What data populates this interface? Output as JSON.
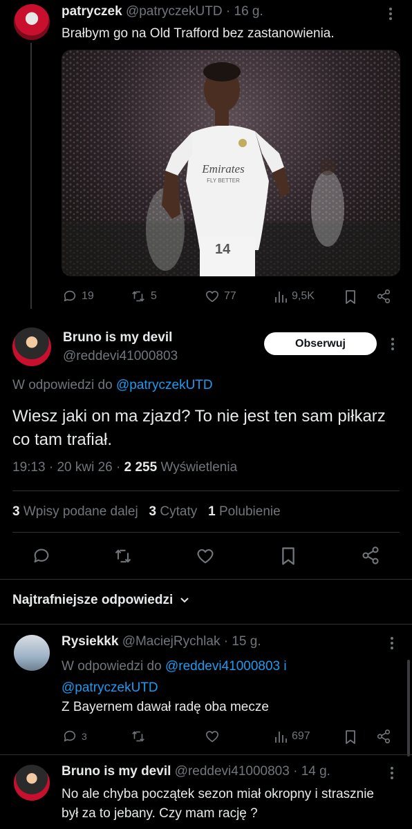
{
  "tweet1": {
    "name": "patryczek",
    "handle": "@patryczekUTD",
    "time": "16 g.",
    "text": "Brałbym go na Old Trafford bez zastanowienia.",
    "stats": {
      "replies": "19",
      "reposts": "5",
      "likes": "77",
      "views": "9,5K"
    }
  },
  "main": {
    "name": "Bruno is my devil",
    "handle": "@reddevi41000803",
    "follow_label": "Obserwuj",
    "reply_prefix": "W odpowiedzi do",
    "reply_to": "@patryczekUTD",
    "text": "Wiesz jaki on ma zjazd? To nie jest ten sam piłkarz co tam trafiał.",
    "time": "19:13",
    "date": "20 kwi 26",
    "views_count": "2 255",
    "views_label": "Wyświetlenia",
    "reposts_count": "3",
    "reposts_label": "Wpisy podane dalej",
    "quotes_count": "3",
    "quotes_label": "Cytaty",
    "likes_count": "1",
    "likes_label": "Polubienie"
  },
  "sort_label": "Najtrafniejsze odpowiedzi",
  "reply1": {
    "name": "Rysiekkk",
    "handle": "@MaciejRychlak",
    "time": "15 g.",
    "reply_prefix": "W odpowiedzi do",
    "reply_to_1": "@reddevi41000803",
    "reply_and": "i",
    "reply_to_2": "@patryczekUTD",
    "text": "Z Bayernem dawał radę oba mecze",
    "stats": {
      "replies": "3",
      "views": "697"
    }
  },
  "reply2": {
    "name": "Bruno is my devil",
    "handle": "@reddevi41000803",
    "time": "14 g.",
    "text": "No ale chyba początek sezon miał okropny i strasznie był za to jebany. Czy mam rację ?"
  },
  "photo_text": {
    "sponsor": "Emirates",
    "sponsor_sub": "FLY BETTER",
    "number": "14"
  },
  "colors": {
    "accent": "#1d9bf0",
    "muted": "#71767b",
    "bg": "#000000"
  }
}
